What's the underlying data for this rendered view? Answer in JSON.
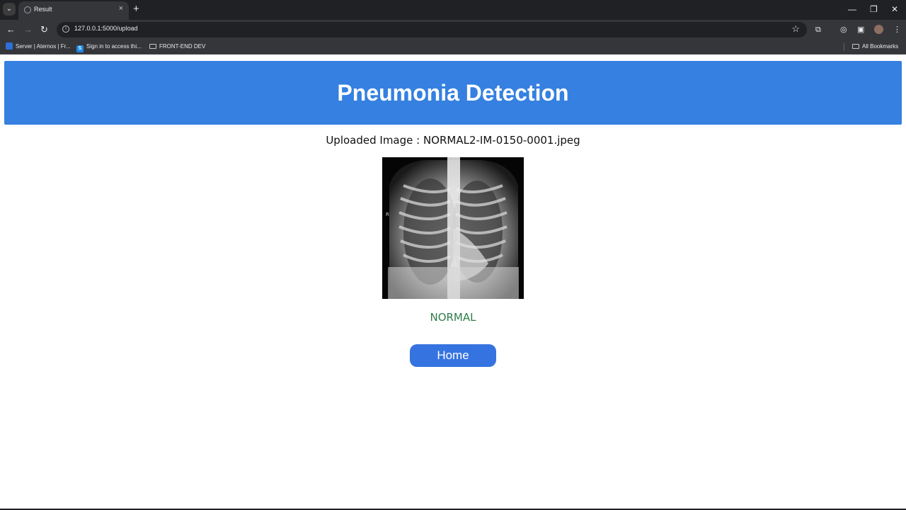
{
  "browser": {
    "tab_title": "Result",
    "tab_close_icon": "×",
    "new_tab_icon": "+",
    "url": "127.0.0.1:5000/upload",
    "window_controls": {
      "minimize": "—",
      "restore": "❐",
      "close": "✕"
    },
    "bookmarks": [
      {
        "label": "Server | Aternos | Fr..."
      },
      {
        "label": "Sign in to access thi..."
      },
      {
        "label": "FRONT-END DEV"
      }
    ],
    "all_bookmarks_label": "All Bookmarks"
  },
  "page": {
    "header_title": "Pneumonia Detection",
    "uploaded_text": "Uploaded Image : NORMAL2-IM-0150-0001.jpeg",
    "xray_marker": "R",
    "result_label": "NORMAL",
    "home_button_label": "Home"
  },
  "colors": {
    "header_bg": "#3580e0",
    "result_text": "#2e7d4a",
    "button_bg": "#3573e0"
  }
}
